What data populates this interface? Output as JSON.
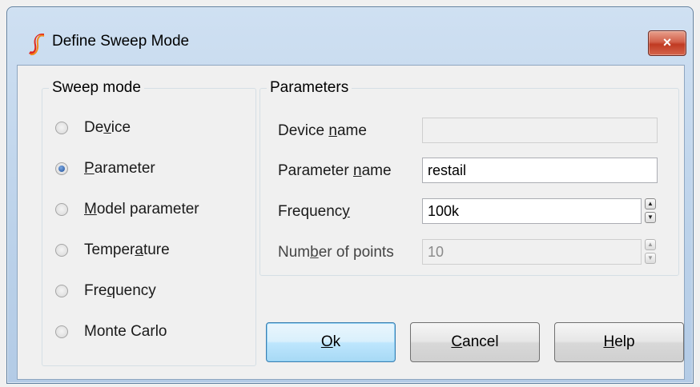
{
  "window": {
    "title": "Define Sweep Mode",
    "close_label": "×"
  },
  "sweep_mode": {
    "group_label": "Sweep mode",
    "options": [
      {
        "pre": "De",
        "key": "v",
        "post": "ice",
        "selected": false
      },
      {
        "pre": "",
        "key": "P",
        "post": "arameter",
        "selected": true
      },
      {
        "pre": "",
        "key": "M",
        "post": "odel parameter",
        "selected": false
      },
      {
        "pre": "Temper",
        "key": "a",
        "post": "ture",
        "selected": false
      },
      {
        "pre": "Fre",
        "key": "q",
        "post": "uency",
        "selected": false
      },
      {
        "pre": "Monte Carlo",
        "key": "",
        "post": "",
        "selected": false
      }
    ]
  },
  "parameters": {
    "group_label": "Parameters",
    "device_name": {
      "pre": "Device ",
      "key": "n",
      "post": "ame",
      "value": ""
    },
    "parameter_name": {
      "pre": "Parameter ",
      "key": "n",
      "post": "ame",
      "value": "restail"
    },
    "frequency": {
      "pre": "Frequenc",
      "key": "y",
      "post": "",
      "value": "100k"
    },
    "number_of_points": {
      "pre": "Num",
      "key": "b",
      "post": "er of points",
      "value": "10"
    }
  },
  "buttons": {
    "ok": {
      "pre": "",
      "key": "O",
      "post": "k"
    },
    "cancel": {
      "pre": "",
      "key": "C",
      "post": "ancel"
    },
    "help": {
      "pre": "",
      "key": "H",
      "post": "elp"
    }
  },
  "colors": {
    "accent": "#3c7fb1",
    "title_bar": "#bcd2ea",
    "close": "#c03a22",
    "logo": "#e0281e"
  },
  "icons": {
    "app": "simetrix-logo",
    "close": "close-icon",
    "spin_up": "spin-up-icon",
    "spin_down": "spin-down-icon"
  }
}
